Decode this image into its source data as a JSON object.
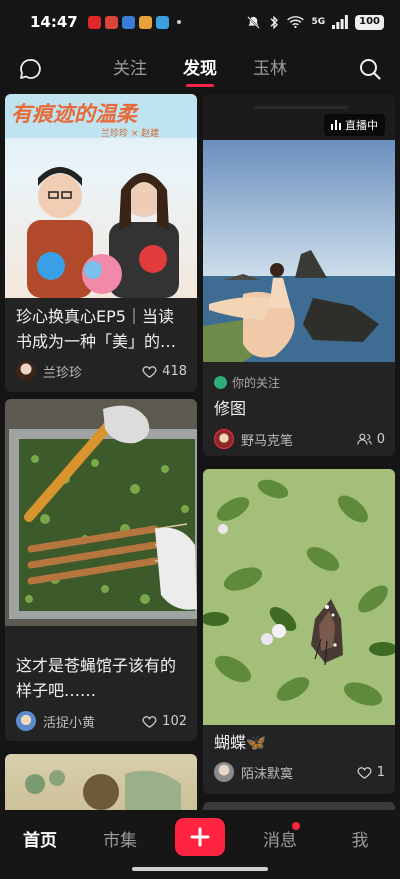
{
  "status": {
    "time": "14:47",
    "battery": "100",
    "network": "5G"
  },
  "topnav": {
    "tabs": [
      "关注",
      "发现",
      "玉林"
    ],
    "active_tab": "发现"
  },
  "feed": {
    "left": [
      {
        "title": "珍心换真心EP5｜当读书成为一种「美」的…",
        "author": "兰珍珍",
        "likes": "418",
        "image_text": "有痕迹的温柔",
        "image_subtext": "兰珍珍 × 赵建"
      },
      {
        "title": "这才是苍蝇馆子该有的样子吧……",
        "author": "活捉小黄",
        "likes": "102"
      }
    ],
    "right": [
      {
        "live_label": "直播中",
        "follow_label": "你的关注",
        "title": "修图",
        "author": "野马克笔",
        "viewers": "0"
      },
      {
        "title": "蝴蝶🦋",
        "author": "陌沫默寞",
        "likes": "1"
      }
    ]
  },
  "bottomnav": {
    "items": [
      "首页",
      "市集",
      "消息",
      "我"
    ]
  },
  "colors": {
    "accent": "#ff2442",
    "background": "#151515",
    "card": "#232323"
  }
}
